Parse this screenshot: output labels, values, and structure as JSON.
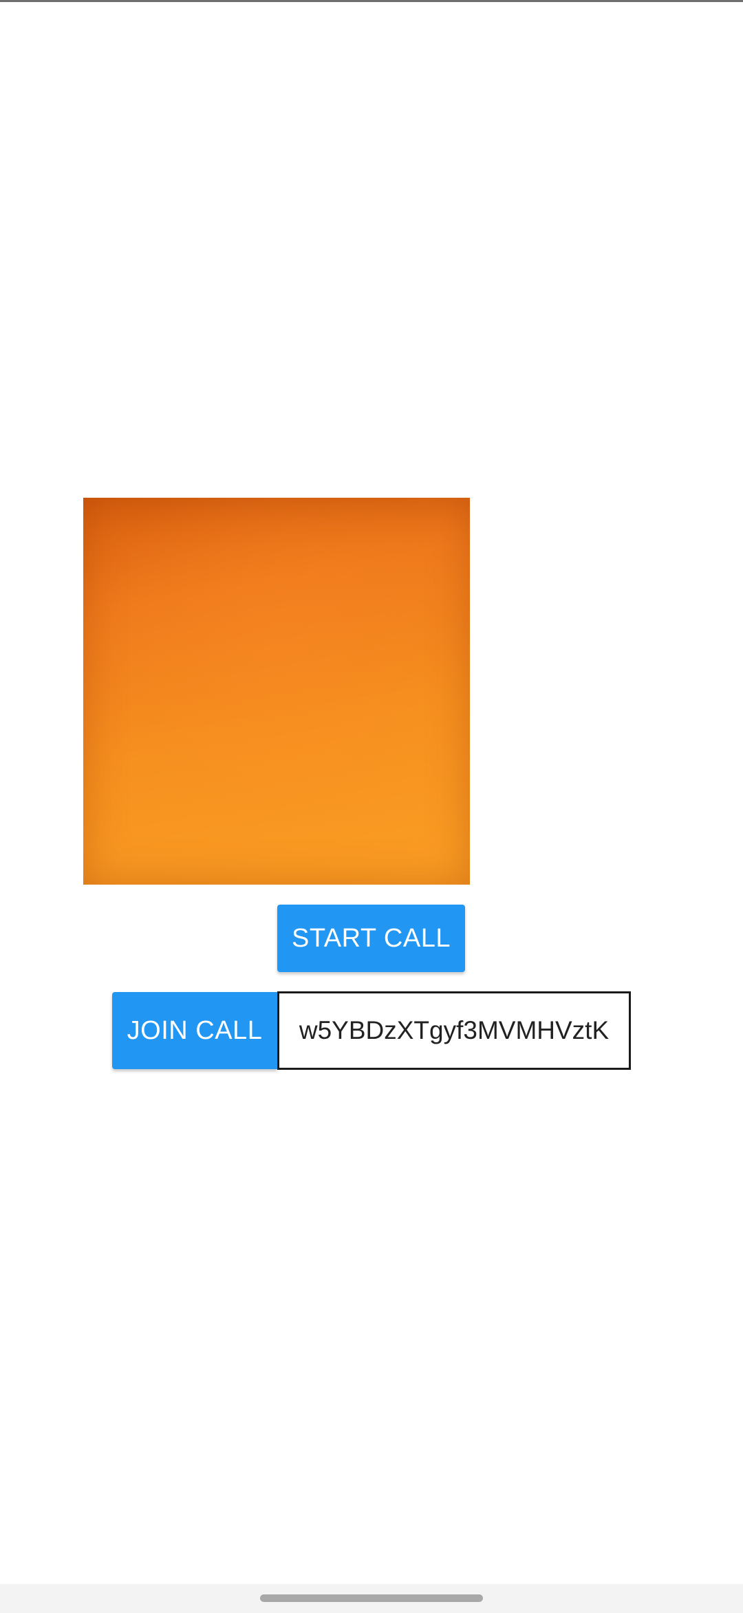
{
  "video": {
    "preview_color": "#f68a1e"
  },
  "actions": {
    "start_call_label": "START CALL",
    "join_call_label": "JOIN CALL",
    "accent_color": "#2196f3"
  },
  "call_id": {
    "value": "w5YBDzXTgyf3MVMHVztK"
  }
}
